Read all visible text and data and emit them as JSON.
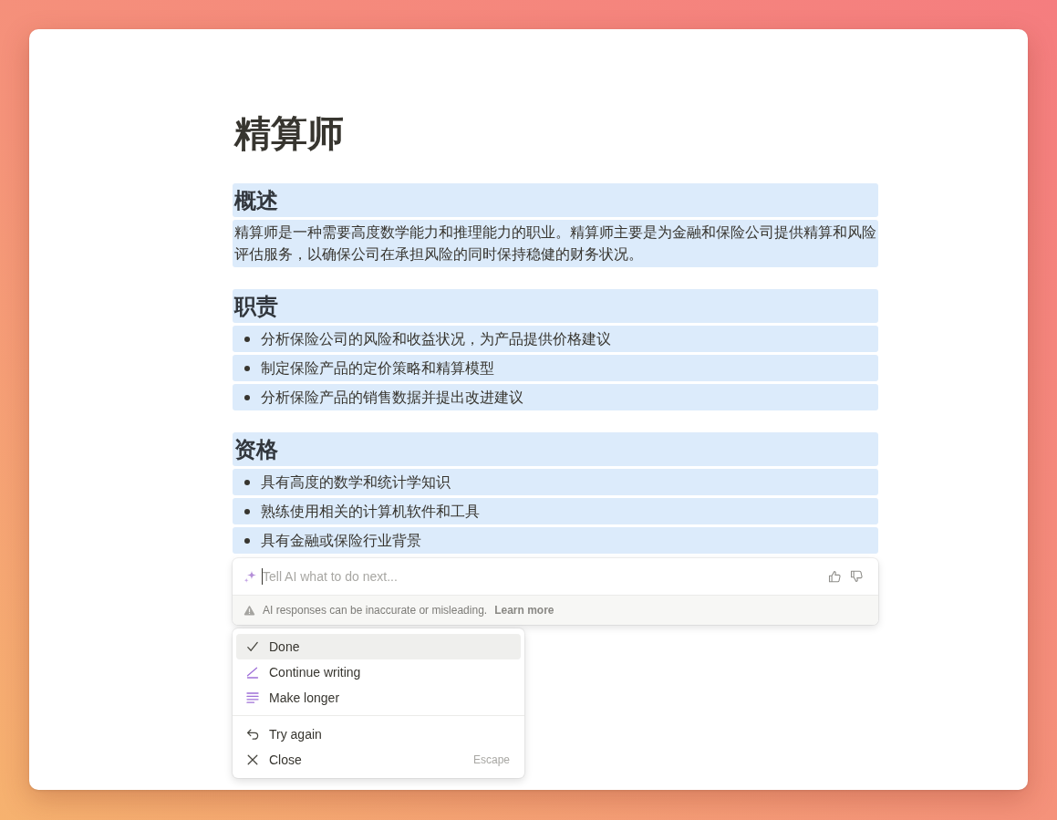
{
  "page": {
    "title": "精算师",
    "blocks": [
      {
        "kind": "heading",
        "text": "概述",
        "highlighted": true
      },
      {
        "kind": "paragraph",
        "text": "精算师是一种需要高度数学能力和推理能力的职业。精算师主要是为金融和保险公司提供精算和风险评估服务，以确保公司在承担风险的同时保持稳健的财务状况。",
        "highlighted": true
      },
      {
        "kind": "heading",
        "text": "职责",
        "highlighted": true
      },
      {
        "kind": "bullet",
        "text": "分析保险公司的风险和收益状况，为产品提供价格建议",
        "highlighted": true
      },
      {
        "kind": "bullet",
        "text": "制定保险产品的定价策略和精算模型",
        "highlighted": true
      },
      {
        "kind": "bullet",
        "text": "分析保险产品的销售数据并提出改进建议",
        "highlighted": true
      },
      {
        "kind": "heading",
        "text": "资格",
        "highlighted": true
      },
      {
        "kind": "bullet",
        "text": "具有高度的数学和统计学知识",
        "highlighted": true
      },
      {
        "kind": "bullet",
        "text": "熟练使用相关的计算机软件和工具",
        "highlighted": true
      },
      {
        "kind": "bullet",
        "text": "具有金融或保险行业背景",
        "highlighted": true
      }
    ]
  },
  "ai_prompt": {
    "placeholder": "Tell AI what to do next...",
    "focused": true,
    "warning": "AI responses can be inaccurate or misleading.",
    "learn_more": "Learn more"
  },
  "menu": {
    "groups": [
      {
        "items": [
          {
            "label": "Done",
            "selected": true
          },
          {
            "label": "Continue writing",
            "selected": false
          },
          {
            "label": "Make longer",
            "selected": false
          }
        ]
      },
      {
        "items": [
          {
            "label": "Try again",
            "selected": false
          },
          {
            "label": "Close",
            "selected": false,
            "shortcut": "Escape"
          }
        ]
      }
    ]
  }
}
